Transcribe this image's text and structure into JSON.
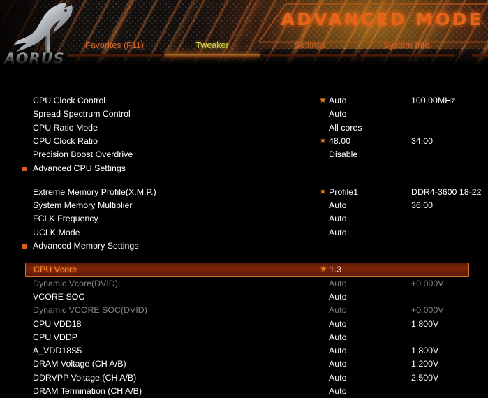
{
  "header": {
    "brand": "AORUS",
    "brand_icon": "aorus-falcon-logo",
    "mode_title": "ADVANCED MODE",
    "tabs": [
      {
        "label": "Favorites (F11)",
        "active": false
      },
      {
        "label": "Tweaker",
        "active": true
      },
      {
        "label": "Settings",
        "active": false
      },
      {
        "label": "System Info.",
        "active": false
      }
    ]
  },
  "settings": {
    "groups": [
      {
        "name": "cpu",
        "rows": [
          {
            "label": "CPU Clock Control",
            "value": "Auto",
            "value2": "100.00MHz",
            "star": true,
            "bullet": false,
            "enabled": true,
            "selected": false
          },
          {
            "label": "Spread Spectrum Control",
            "value": "Auto",
            "value2": "",
            "star": false,
            "bullet": false,
            "enabled": true,
            "selected": false
          },
          {
            "label": "CPU Ratio Mode",
            "value": "All cores",
            "value2": "",
            "star": false,
            "bullet": false,
            "enabled": true,
            "selected": false
          },
          {
            "label": "CPU Clock Ratio",
            "value": "48.00",
            "value2": "34.00",
            "star": true,
            "bullet": false,
            "enabled": true,
            "selected": false
          },
          {
            "label": "Precision Boost Overdrive",
            "value": "Disable",
            "value2": "",
            "star": false,
            "bullet": false,
            "enabled": true,
            "selected": false
          },
          {
            "label": "Advanced CPU Settings",
            "value": "",
            "value2": "",
            "star": false,
            "bullet": true,
            "enabled": true,
            "selected": false
          }
        ]
      },
      {
        "name": "memory",
        "rows": [
          {
            "label": "Extreme Memory Profile(X.M.P.)",
            "value": "Profile1",
            "value2": "DDR4-3600 18-22",
            "star": true,
            "bullet": false,
            "enabled": true,
            "selected": false
          },
          {
            "label": "System Memory Multiplier",
            "value": "Auto",
            "value2": "36.00",
            "star": false,
            "bullet": false,
            "enabled": true,
            "selected": false
          },
          {
            "label": "FCLK Frequency",
            "value": "Auto",
            "value2": "",
            "star": false,
            "bullet": false,
            "enabled": true,
            "selected": false
          },
          {
            "label": "UCLK Mode",
            "value": "Auto",
            "value2": "",
            "star": false,
            "bullet": false,
            "enabled": true,
            "selected": false
          },
          {
            "label": "Advanced Memory Settings",
            "value": "",
            "value2": "",
            "star": false,
            "bullet": true,
            "enabled": true,
            "selected": false
          }
        ]
      },
      {
        "name": "voltage",
        "rows": [
          {
            "label": "CPU Vcore",
            "value": "1.3",
            "value2": "",
            "star": true,
            "bullet": false,
            "enabled": true,
            "selected": true
          },
          {
            "label": "Dynamic Vcore(DVID)",
            "value": "Auto",
            "value2": "+0.000V",
            "star": false,
            "bullet": false,
            "enabled": false,
            "selected": false
          },
          {
            "label": "VCORE SOC",
            "value": "Auto",
            "value2": "",
            "star": false,
            "bullet": false,
            "enabled": true,
            "selected": false
          },
          {
            "label": "Dynamic VCORE SOC(DVID)",
            "value": "Auto",
            "value2": "+0.000V",
            "star": false,
            "bullet": false,
            "enabled": false,
            "selected": false
          },
          {
            "label": "CPU VDD18",
            "value": "Auto",
            "value2": "1.800V",
            "star": false,
            "bullet": false,
            "enabled": true,
            "selected": false
          },
          {
            "label": "CPU VDDP",
            "value": "Auto",
            "value2": "",
            "star": false,
            "bullet": false,
            "enabled": true,
            "selected": false
          },
          {
            "label": "A_VDD18S5",
            "value": "Auto",
            "value2": "1.800V",
            "star": false,
            "bullet": false,
            "enabled": true,
            "selected": false
          },
          {
            "label": "DRAM Voltage      (CH A/B)",
            "value": "Auto",
            "value2": "1.200V",
            "star": false,
            "bullet": false,
            "enabled": true,
            "selected": false
          },
          {
            "label": "DDRVPP Voltage   (CH A/B)",
            "value": "Auto",
            "value2": "2.500V",
            "star": false,
            "bullet": false,
            "enabled": true,
            "selected": false
          },
          {
            "label": "DRAM Termination  (CH A/B)",
            "value": "Auto",
            "value2": "",
            "star": false,
            "bullet": false,
            "enabled": true,
            "selected": false
          }
        ]
      }
    ]
  },
  "colors": {
    "accent_orange": "#e8641a",
    "active_tab_text": "#d9d94a",
    "inactive_tab_text": "#c7652c",
    "selected_row_text": "#ff8c34",
    "disabled_text": "#848484",
    "background": "#000000"
  }
}
